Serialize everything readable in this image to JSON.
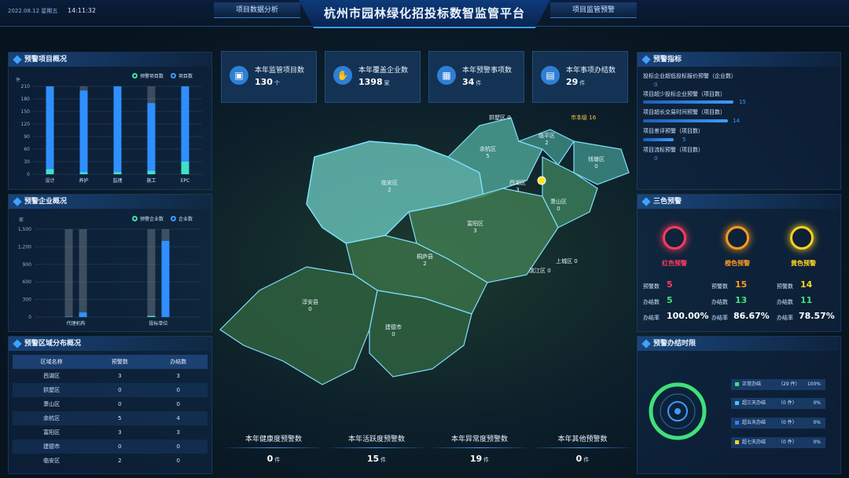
{
  "header": {
    "date": "2022.08.12",
    "weekday": "星期五",
    "time": "14:11:32",
    "title": "杭州市园林绿化招投标数智监管平台",
    "tab_left": "项目数据分析",
    "tab_right": "项目监管预警"
  },
  "stats": [
    {
      "label": "本年监管项目数",
      "value": "130",
      "unit": "个",
      "icon": "briefcase-icon"
    },
    {
      "label": "本年覆盖企业数",
      "value": "1398",
      "unit": "家",
      "icon": "hand-icon"
    },
    {
      "label": "本年预警事项数",
      "value": "34",
      "unit": "件",
      "icon": "box-icon"
    },
    {
      "label": "本年事项办结数",
      "value": "29",
      "unit": "件",
      "icon": "calendar-icon"
    }
  ],
  "bottom_stats": [
    {
      "label": "本年健康度预警数",
      "value": "0",
      "unit": "件"
    },
    {
      "label": "本年活跃度预警数",
      "value": "15",
      "unit": "件"
    },
    {
      "label": "本年异常度预警数",
      "value": "19",
      "unit": "件"
    },
    {
      "label": "本年其他预警数",
      "value": "0",
      "unit": "件"
    }
  ],
  "project_panel": {
    "title": "预警项目概况",
    "legend": [
      "预警项目数",
      "项目数"
    ],
    "unit": "件"
  },
  "enterprise_panel": {
    "title": "预警企业概况",
    "legend": [
      "预警企业数",
      "企业数"
    ],
    "unit": "家"
  },
  "region_panel": {
    "title": "预警区域分布概况",
    "columns": [
      "区域名称",
      "预警数",
      "办结数"
    ],
    "rows": [
      [
        "西湖区",
        "3",
        "3"
      ],
      [
        "拱墅区",
        "0",
        "0"
      ],
      [
        "萧山区",
        "0",
        "0"
      ],
      [
        "余杭区",
        "5",
        "4"
      ],
      [
        "富阳区",
        "3",
        "3"
      ],
      [
        "建德市",
        "0",
        "0"
      ],
      [
        "临安区",
        "2",
        "0"
      ]
    ]
  },
  "warning_index": {
    "title": "预警指标",
    "items": [
      {
        "label": "投标企业超低投标报价预警（企业数）",
        "value": "0",
        "fraction": 0.0
      },
      {
        "label": "项目超少投标企业预警（项目数）",
        "value": "15",
        "fraction": 0.92
      },
      {
        "label": "项目超长交易时间预警（项目数）",
        "value": "14",
        "fraction": 0.86
      },
      {
        "label": "项目差评预警（项目数）",
        "value": "5",
        "fraction": 0.31
      },
      {
        "label": "项目流标预警（项目数）",
        "value": "0",
        "fraction": 0.0
      }
    ]
  },
  "three_color": {
    "title": "三色预警",
    "labels": [
      "红色预警",
      "橙色预警",
      "黄色预警"
    ],
    "colors": [
      "#ff3b5c",
      "#ff9a1f",
      "#ffd21f"
    ],
    "warn_label": "预警数",
    "done_label": "办结数",
    "rate_label": "办结率",
    "warn": [
      "5",
      "15",
      "14"
    ],
    "done": [
      "5",
      "13",
      "11"
    ],
    "rate": [
      "100.00%",
      "86.67%",
      "78.57%"
    ]
  },
  "deadline": {
    "title": "预警办结时限",
    "items": [
      {
        "label": "正常办结",
        "count": "（29 件）",
        "pct": "100%",
        "color": "#3fe07a"
      },
      {
        "label": "超三天办结",
        "count": "（0 件）",
        "pct": "0%",
        "color": "#3fc8ff"
      },
      {
        "label": "超五天办结",
        "count": "（0 件）",
        "pct": "0%",
        "color": "#2f7fff"
      },
      {
        "label": "超七天办结",
        "count": "（0 件）",
        "pct": "0%",
        "color": "#ffd21f"
      }
    ]
  },
  "map_labels": [
    {
      "name": "拱墅区",
      "value": "0"
    },
    {
      "name": "市本级",
      "value": "16"
    },
    {
      "name": "临平区",
      "value": "2"
    },
    {
      "name": "余杭区",
      "value": "5"
    },
    {
      "name": "钱塘区",
      "value": "0"
    },
    {
      "name": "临安区",
      "value": "2"
    },
    {
      "name": "西湖区",
      "value": "3"
    },
    {
      "name": "萧山区",
      "value": "0"
    },
    {
      "name": "富阳区",
      "value": "3"
    },
    {
      "name": "上城区",
      "value": "0"
    },
    {
      "name": "滨江区",
      "value": "0"
    },
    {
      "name": "桐庐县",
      "value": "2"
    },
    {
      "name": "淳安县",
      "value": "0"
    },
    {
      "name": "建德市",
      "value": "0"
    }
  ],
  "chart_data": [
    {
      "type": "bar",
      "title": "预警项目概况",
      "ylabel": "件",
      "ylim": [
        0,
        210
      ],
      "yticks": [
        "0",
        "30",
        "60",
        "90",
        "120",
        "150",
        "180",
        "210"
      ],
      "categories": [
        "设计",
        "养护",
        "监理",
        "施工",
        "EPC"
      ],
      "series": [
        {
          "name": "预警项目数",
          "values": [
            12,
            5,
            5,
            8,
            30
          ]
        },
        {
          "name": "项目数",
          "values": [
            210,
            200,
            210,
            170,
            210
          ]
        }
      ]
    },
    {
      "type": "bar",
      "title": "预警企业概况",
      "ylabel": "家",
      "ylim": [
        0,
        1500
      ],
      "yticks": [
        "0",
        "150",
        "300",
        "450",
        "600",
        "750",
        "900",
        "1,050",
        "1,200",
        "1,350",
        "1,500"
      ],
      "categories": [
        "代理机构",
        "投标单位"
      ],
      "series": [
        {
          "name": "预警企业数",
          "values": [
            5,
            20
          ]
        },
        {
          "name": "企业数",
          "values": [
            80,
            1300
          ]
        }
      ]
    }
  ]
}
